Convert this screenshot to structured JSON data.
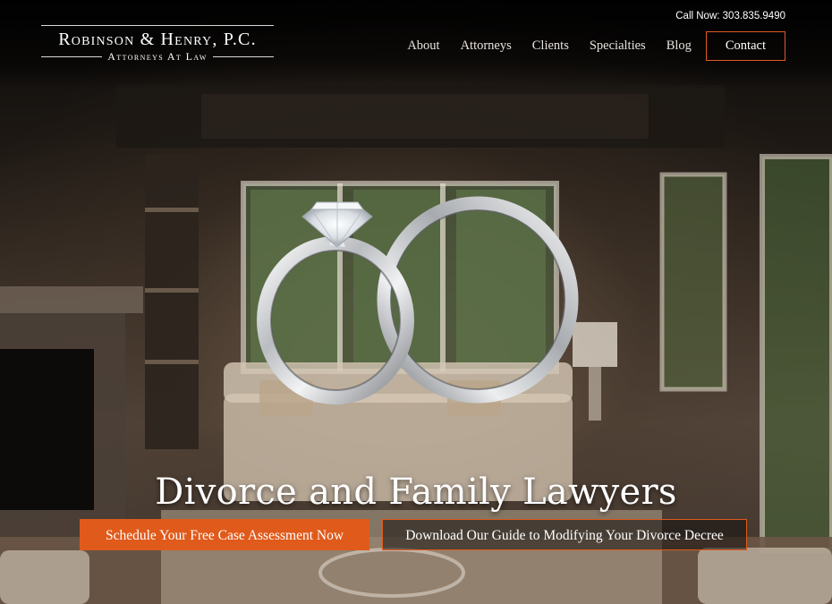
{
  "logo": {
    "name": "Robinson & Henry, P.C.",
    "tagline": "Attorneys At Law"
  },
  "header": {
    "call_label": "Call Now: 303.835.9490"
  },
  "nav": {
    "items": [
      {
        "label": "About"
      },
      {
        "label": "Attorneys"
      },
      {
        "label": "Clients"
      },
      {
        "label": "Specialties"
      },
      {
        "label": "Blog"
      }
    ],
    "contact_label": "Contact"
  },
  "hero": {
    "headline": "Divorce and Family Lawyers",
    "primary_cta": "Schedule Your Free Case Assessment Now",
    "secondary_cta": "Download Our Guide to Modifying Your Divorce Decree"
  },
  "colors": {
    "accent": "#e05a1b",
    "text": "#ffffff"
  },
  "icons": {
    "rings": "wedding-rings-image"
  }
}
